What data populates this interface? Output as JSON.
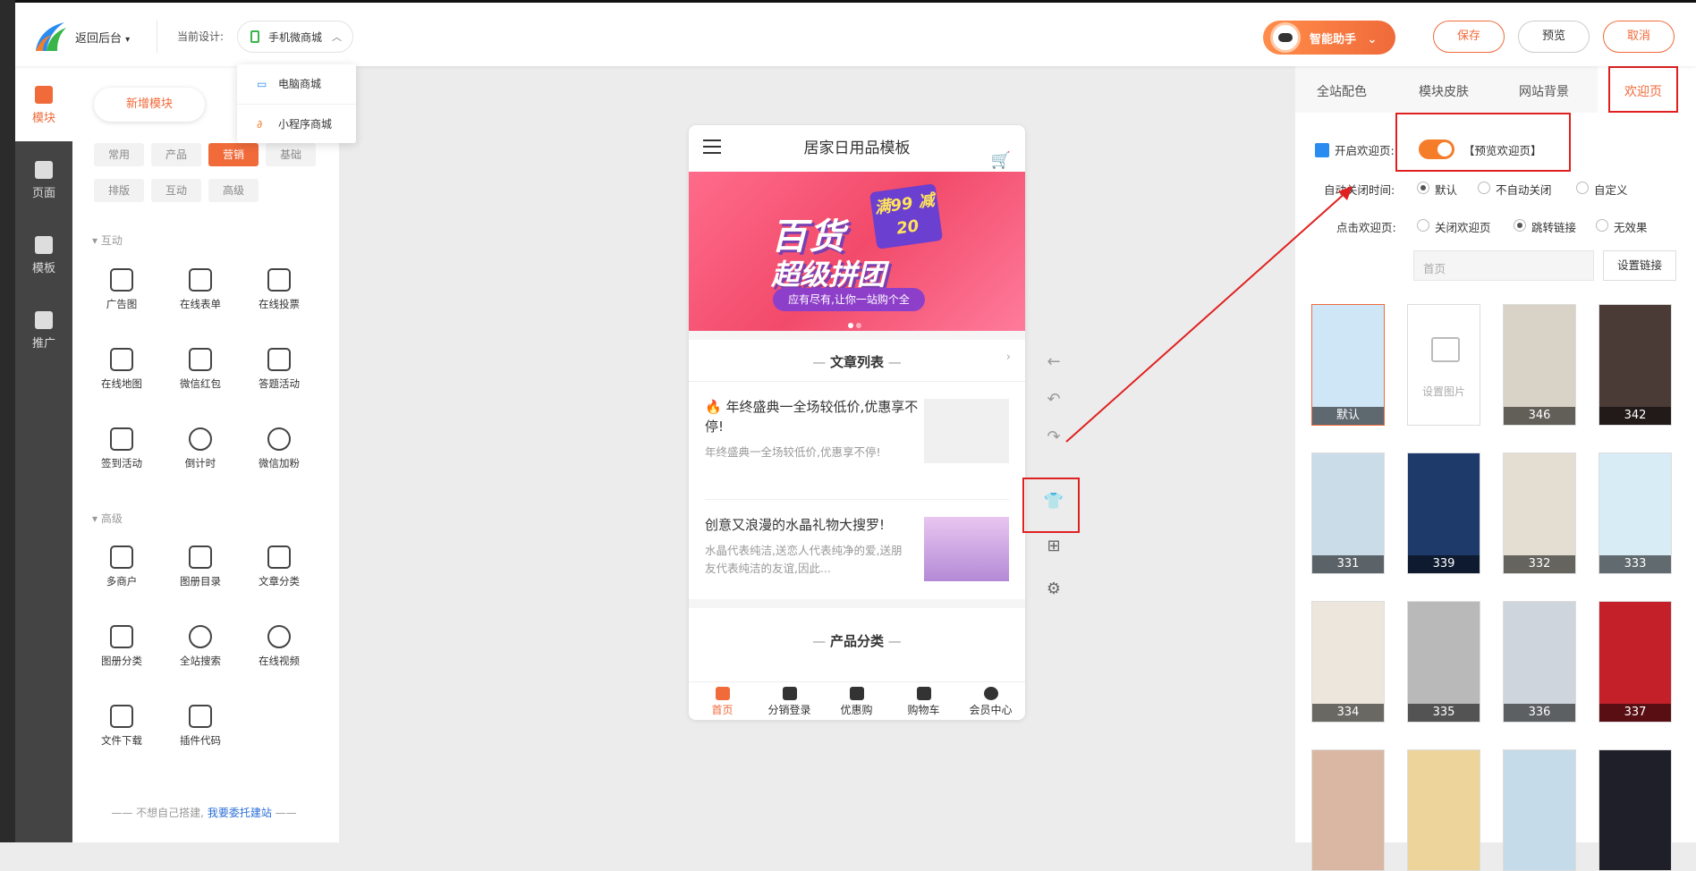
{
  "topbar": {
    "back_label": "返回后台",
    "current_design_label": "当前设计:",
    "current_design": "手机微商城",
    "dropdown_items": [
      "电脑商城",
      "小程序商城"
    ],
    "ai_assistant": "智能助手",
    "save": "保存",
    "preview": "预览",
    "cancel": "取消"
  },
  "sidenav": {
    "items": [
      {
        "label": "模块",
        "icon": "module-icon",
        "active": true
      },
      {
        "label": "页面",
        "icon": "page-icon"
      },
      {
        "label": "模板",
        "icon": "template-icon"
      },
      {
        "label": "推广",
        "icon": "megaphone-icon"
      }
    ]
  },
  "panel": {
    "tab_new": "新增模块",
    "categories": [
      "常用",
      "产品",
      "营销",
      "基础",
      "排版",
      "互动",
      "高级"
    ],
    "active_category": "营销",
    "section_interactive": "互动",
    "section_advanced": "高级",
    "interactive_modules": [
      "广告图",
      "在线表单",
      "在线投票",
      "在线地图",
      "微信红包",
      "答题活动",
      "签到活动",
      "倒计时",
      "微信加粉"
    ],
    "advanced_modules": [
      "多商户",
      "图册目录",
      "文章分类",
      "图册分类",
      "全站搜索",
      "在线视频",
      "文件下载",
      "插件代码"
    ],
    "footer_text": "不想自己搭建,",
    "footer_link": "我要委托建站"
  },
  "phone": {
    "title": "居家日用品模板",
    "banner": {
      "line1": "百货",
      "line2": "超级拼团",
      "badge": "满99 减20",
      "tagline": "应有尽有,让你一站购个全"
    },
    "article_section": "文章列表",
    "articles": [
      {
        "title": "🔥 年终盛典一全场较低价,优惠享不停!",
        "desc": "年终盛典一全场较低价,优惠享不停!"
      },
      {
        "title": "创意又浪漫的水晶礼物大搜罗!",
        "desc": "水晶代表纯洁,送恋人代表纯净的爱,送朋友代表纯洁的友谊,因此..."
      }
    ],
    "product_section": "产品分类",
    "tabbar": [
      "首页",
      "分销登录",
      "优惠购",
      "购物车",
      "会员中心"
    ]
  },
  "right": {
    "tabs": [
      "全站配色",
      "模块皮肤",
      "网站背景",
      "欢迎页"
    ],
    "active_tab": "欢迎页",
    "enable_label": "开启欢迎页:",
    "enabled": true,
    "preview_link": "【预览欢迎页】",
    "auto_close_label": "自动关闭时间:",
    "auto_close_options": [
      "默认",
      "不自动关闭",
      "自定义"
    ],
    "auto_close_selected": "默认",
    "click_label": "点击欢迎页:",
    "click_options": [
      "关闭欢迎页",
      "跳转链接",
      "无效果"
    ],
    "click_selected": "跳转链接",
    "link_value": "首页",
    "set_link": "设置链接",
    "thumbs": [
      {
        "label": "默认",
        "color": "#cfe6f6",
        "selected": true
      },
      {
        "label": "设置图片",
        "blank": true
      },
      {
        "label": "346",
        "color": "#d9d2c6"
      },
      {
        "label": "342",
        "color": "#4a3b36"
      },
      {
        "label": "331",
        "color": "#c9dce8"
      },
      {
        "label": "339",
        "color": "#1d3a6b"
      },
      {
        "label": "332",
        "color": "#e3ddd2"
      },
      {
        "label": "333",
        "color": "#d8ecf5"
      },
      {
        "label": "334",
        "color": "#ece6dc"
      },
      {
        "label": "335",
        "color": "#b9b9b9"
      },
      {
        "label": "336",
        "color": "#cfd5dc"
      },
      {
        "label": "337",
        "color": "#c4202a"
      },
      {
        "label": "",
        "color": "#d9b7a2"
      },
      {
        "label": "",
        "color": "#ecd49a"
      },
      {
        "label": "",
        "color": "#c6dbe9"
      },
      {
        "label": "",
        "color": "#1f1f2a"
      }
    ]
  }
}
